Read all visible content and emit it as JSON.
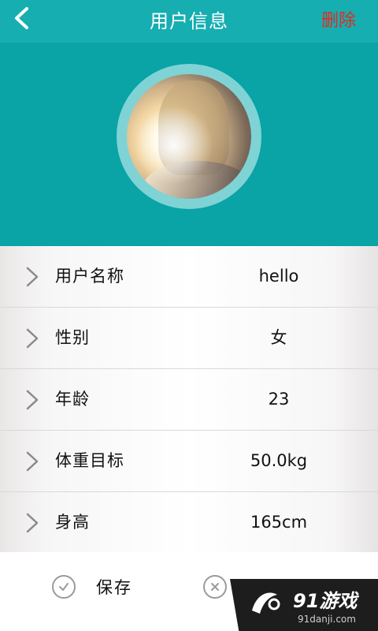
{
  "header": {
    "title": "用户信息",
    "delete_label": "删除",
    "back_icon": "chevron-left-icon"
  },
  "profile": {
    "avatar_icon": "user-photo"
  },
  "fields": [
    {
      "label": "用户名称",
      "value": "hello"
    },
    {
      "label": "性别",
      "value": "女"
    },
    {
      "label": "年龄",
      "value": "23"
    },
    {
      "label": "体重目标",
      "value": "50.0kg"
    },
    {
      "label": "身高",
      "value": "165cm"
    }
  ],
  "actions": {
    "save_label": "保存",
    "cancel_label": "取消"
  },
  "watermark": {
    "brand": "91游戏",
    "site": "91danji.com"
  },
  "colors": {
    "header_bg": "#0aa3a6",
    "topbar_bg": "#16aeb1",
    "delete_text": "#e02b22",
    "avatar_ring": "#7fd3d5"
  }
}
